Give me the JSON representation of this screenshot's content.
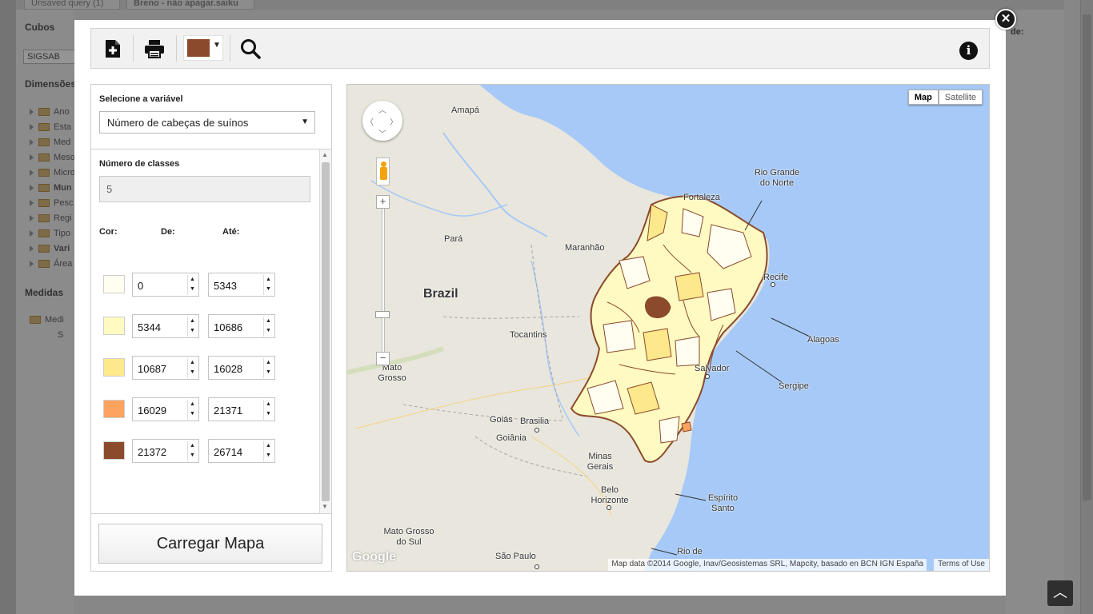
{
  "background_app": {
    "tabs": [
      "Unsaved query (1)",
      "Breno - não apagar.saiku"
    ],
    "cubes_heading": "Cubos",
    "cube_select": "SIGSAB",
    "dimensions_heading": "Dimensões",
    "dimension_items": [
      "Ano",
      "Esta",
      "Med",
      "Meso",
      "Micro",
      "Mun",
      "Pesc",
      "Regi",
      "Tipo",
      "Vari",
      "Área"
    ],
    "measures_heading": "Medidas",
    "measure_items": [
      "Medi",
      "S"
    ],
    "right_label": "de:"
  },
  "toolbar": {
    "new_icon": "new-document-icon",
    "print_icon": "print-icon",
    "color_selected": "#8b4a2c",
    "search_icon": "search-icon",
    "info_icon": "info-icon"
  },
  "panel": {
    "variable_label": "Selecione a variável",
    "variable_value": "Número de cabeças de suínos",
    "classes_label": "Número de classes",
    "classes_value": "5",
    "col_color": "Cor:",
    "col_from": "De:",
    "col_to": "Até:",
    "classes": [
      {
        "color": "#fffef0",
        "from": "0",
        "to": "5343"
      },
      {
        "color": "#fffac2",
        "from": "5344",
        "to": "10686"
      },
      {
        "color": "#fde98c",
        "from": "10687",
        "to": "16028"
      },
      {
        "color": "#fca35f",
        "from": "16029",
        "to": "21371"
      },
      {
        "color": "#8b4a2c",
        "from": "21372",
        "to": "26714"
      }
    ],
    "load_button": "Carregar Mapa"
  },
  "map": {
    "type_buttons": [
      "Map",
      "Satellite"
    ],
    "labels": {
      "amapa": "Amapá",
      "fortaleza": "Fortaleza",
      "rio_grande_do_norte": "Rio Grande do Norte",
      "para": "Pará",
      "maranhao": "Maranhão",
      "recife": "Recife",
      "brazil": "Brazil",
      "tocantins": "Tocantins",
      "alagoas": "Alagoas",
      "mato_grosso": "Mato Grosso",
      "salvador": "Salvador",
      "sergipe": "Sergipe",
      "goias": "Goiás",
      "brasilia": "Brasilia",
      "goiania": "Goiânia",
      "minas_gerais": "Minas Gerais",
      "belo_horizonte": "Belo Horizonte",
      "espirito_santo": "Espírito Santo",
      "mato_grosso_do_sul": "Mato Grosso do Sul",
      "sao_paulo": "São Paulo",
      "rio_de": "Rio de"
    },
    "logo": "Google",
    "attribution": "Map data ©2014 Google, Inav/Geosistemas SRL, Mapcity, basado en BCN IGN España",
    "terms": "Terms of Use"
  }
}
